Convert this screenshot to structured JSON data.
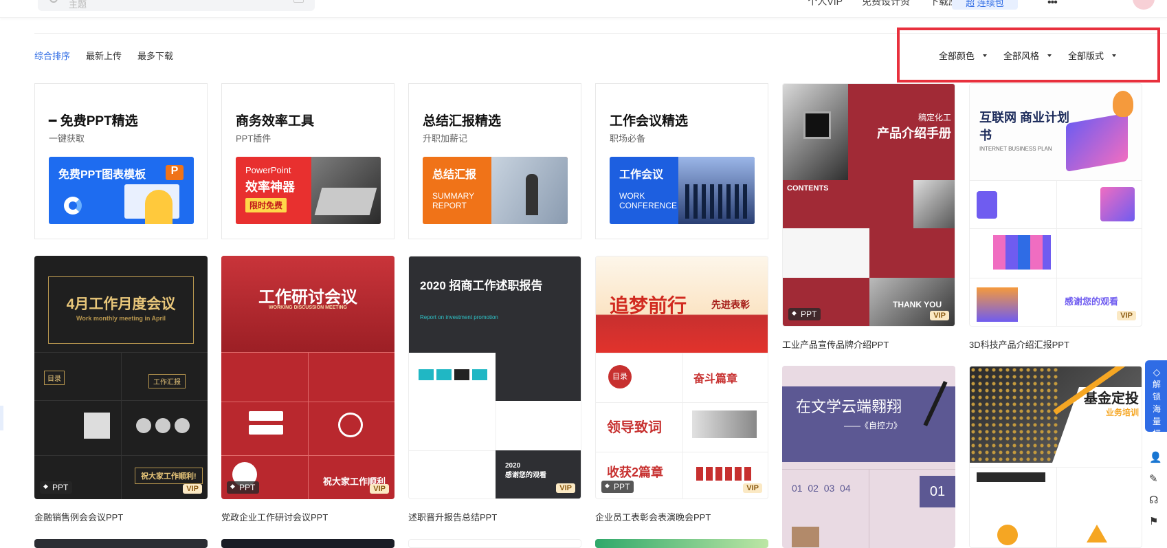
{
  "header": {
    "search_placeholder": "主题",
    "nav": [
      "个人VIP",
      "免费设计资",
      "下载应用"
    ],
    "vip_button": "超 连续包"
  },
  "sort_tabs": [
    {
      "label": "综合排序",
      "active": true
    },
    {
      "label": "最新上传",
      "active": false
    },
    {
      "label": "最多下载",
      "active": false
    }
  ],
  "filters": [
    {
      "label": "全部颜色"
    },
    {
      "label": "全部风格"
    },
    {
      "label": "全部版式"
    }
  ],
  "feature_cards": [
    {
      "title": "━ 免费PPT精选",
      "subtitle": "一键获取",
      "banner_line1": "免费PPT图表模板",
      "banner_line2": "",
      "banner_line3": "",
      "banner_color": "#1e6cf0"
    },
    {
      "title": "商务效率工具",
      "subtitle": "PPT插件",
      "banner_line1": "PowerPoint",
      "banner_line2": "效率神器",
      "banner_line3": "限时免费",
      "banner_color": "#e8302f"
    },
    {
      "title": "总结汇报精选",
      "subtitle": "升职加薪记",
      "banner_line1": "总结汇报",
      "banner_line2": "SUMMARY",
      "banner_line3": "REPORT",
      "banner_color": "#f07318"
    },
    {
      "title": "工作会议精选",
      "subtitle": "职场必备",
      "banner_line1": "工作会议",
      "banner_line2": "WORK",
      "banner_line3": "CONFERENCE",
      "banner_color": "#1d5fe0"
    }
  ],
  "templates": [
    {
      "title": "金融销售例会会议PPT",
      "cover_text": "4月工作月度会议",
      "cover_sub": "Work monthly meeting in April",
      "badge": "PPT",
      "vip": "VIP"
    },
    {
      "title": "党政企业工作研讨会议PPT",
      "cover_text": "工作研讨会议",
      "cover_sub": "WORKING DISCUSSION MEETING",
      "badge": "PPT",
      "vip": "VIP"
    },
    {
      "title": "述职晋升报告总结PPT",
      "cover_text": "2020 招商工作述职报告",
      "cover_sub": "Report on investment promotion",
      "badge": "",
      "vip": "VIP"
    },
    {
      "title": "企业员工表彰会表演晚会PPT",
      "cover_text": "追梦前行",
      "cover_sub": "先进表彰",
      "badge": "PPT",
      "vip": "VIP"
    },
    {
      "title": "工业产品宣传品牌介绍PPT",
      "cover_text": "产品介绍手册",
      "cover_sub": "稿定化工",
      "badge": "PPT",
      "vip": "VIP"
    },
    {
      "title": "3D科技产品介绍汇报PPT",
      "cover_text": "互联网 商业计划书",
      "cover_sub": "INTERNET BUSINESS PLAN",
      "badge": "",
      "vip": "VIP"
    },
    {
      "title": "",
      "cover_text": "在文学云端翱翔",
      "cover_sub": "——《自控力》",
      "badge": "",
      "vip": ""
    },
    {
      "title": "",
      "cover_text": "基金定投",
      "cover_sub": "业务培训",
      "badge": "",
      "vip": ""
    }
  ],
  "side_panel": {
    "unlock_text": "解锁海量模板"
  },
  "colors": {
    "accent": "#2f6ce5",
    "highlight": "#e8303d"
  }
}
